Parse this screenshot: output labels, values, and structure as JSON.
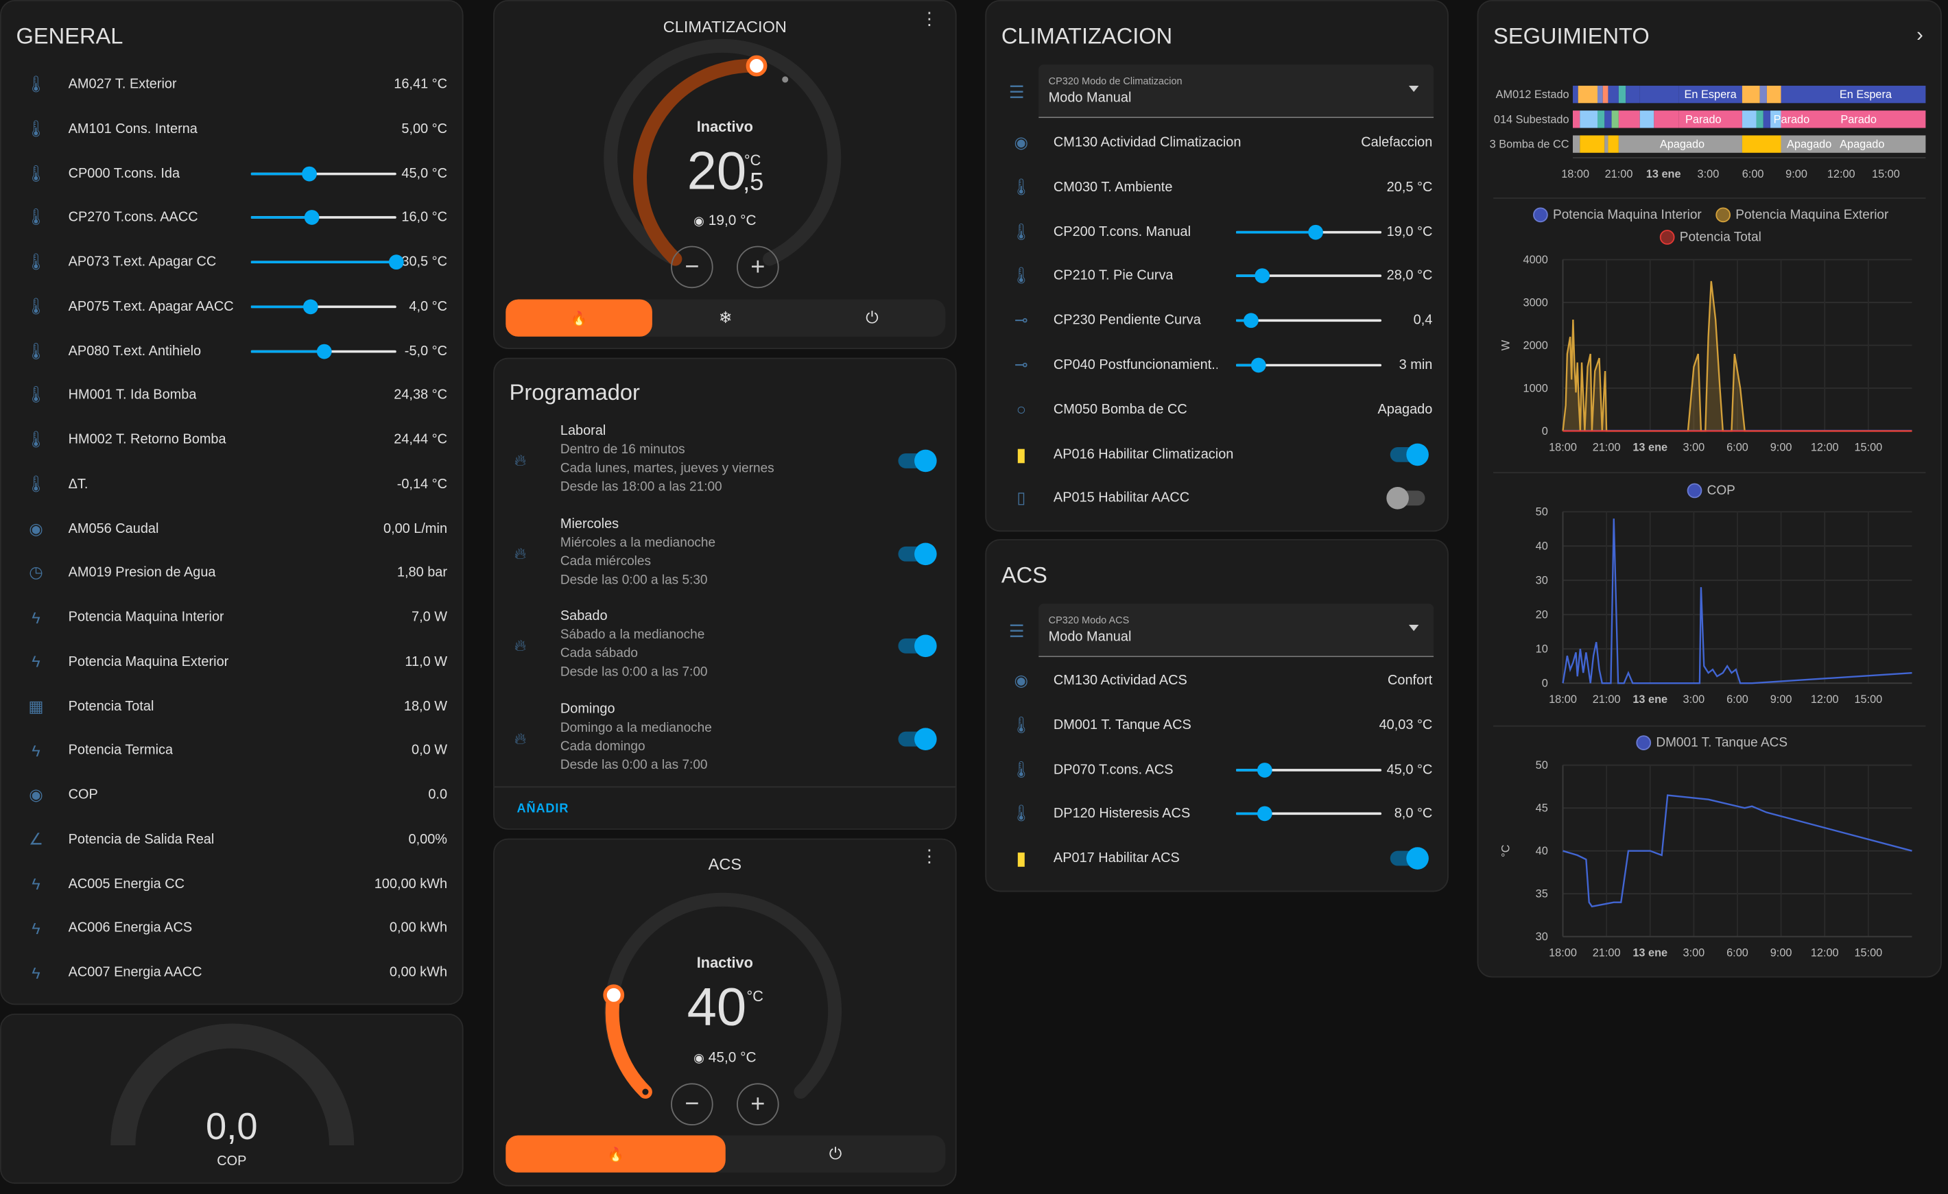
{
  "general": {
    "title": "GENERAL",
    "rows": [
      {
        "icon": "thermometer-icon",
        "label": "AM027 T. Exterior",
        "value": "16,41 °C"
      },
      {
        "icon": "thermometer-icon",
        "label": "AM101 Cons. Interna",
        "value": "5,00 °C"
      },
      {
        "icon": "thermometer-icon",
        "label": "CP000 T.cons. Ida",
        "value": "45,0 °C",
        "slider": 0.4
      },
      {
        "icon": "thermometer-icon",
        "label": "CP270 T.cons. AACC",
        "value": "16,0 °C",
        "slider": 0.42
      },
      {
        "icon": "thermometer-icon",
        "label": "AP073 T.ext. Apagar CC",
        "value": "30,5 °C",
        "slider": 1.0
      },
      {
        "icon": "thermometer-icon",
        "label": "AP075 T.ext. Apagar AACC",
        "value": "4,0 °C",
        "slider": 0.41
      },
      {
        "icon": "thermometer-icon",
        "label": "AP080 T.ext. Antihielo",
        "value": "-5,0 °C",
        "slider": 0.5
      },
      {
        "icon": "thermometer-icon",
        "label": "HM001 T. Ida Bomba",
        "value": "24,38 °C"
      },
      {
        "icon": "thermometer-icon",
        "label": "HM002 T. Retorno Bomba",
        "value": "24,44 °C"
      },
      {
        "icon": "thermometer-icon",
        "label": "ΔT.",
        "value": "-0,14 °C"
      },
      {
        "icon": "eye-icon",
        "label": "AM056 Caudal",
        "value": "0,00 L/min"
      },
      {
        "icon": "gauge-icon",
        "label": "AM019 Presion de Agua",
        "value": "1,80 bar"
      },
      {
        "icon": "flash-icon",
        "label": "Potencia Maquina Interior",
        "value": "7,0 W"
      },
      {
        "icon": "flash-icon",
        "label": "Potencia Maquina Exterior",
        "value": "11,0 W"
      },
      {
        "icon": "calculator-icon",
        "label": "Potencia Total",
        "value": "18,0 W"
      },
      {
        "icon": "flash-icon",
        "label": "Potencia Termica",
        "value": "0,0 W"
      },
      {
        "icon": "eye-icon",
        "label": "COP",
        "value": "0.0"
      },
      {
        "icon": "angle-icon",
        "label": "Potencia de Salida Real",
        "value": "0,00%"
      },
      {
        "icon": "lightning-icon",
        "label": "AC005 Energia CC",
        "value": "100,00 kWh"
      },
      {
        "icon": "lightning-icon",
        "label": "AC006 Energia ACS",
        "value": "0,00 kWh"
      },
      {
        "icon": "lightning-icon",
        "label": "AC007 Energia AACC",
        "value": "0,00 kWh"
      }
    ]
  },
  "cop_gauge": {
    "value": "0,0",
    "label": "COP",
    "fraction": 0
  },
  "thermostat_clim": {
    "title": "CLIMATIZACION",
    "status": "Inactivo",
    "temp_int": "20",
    "temp_dec": ",5",
    "unit": "°C",
    "target": "19,0 °C",
    "minus": "−",
    "plus": "+",
    "modes": [
      {
        "icon": "flame-icon",
        "glyph": "🔥",
        "active": true
      },
      {
        "icon": "snowflake-icon",
        "glyph": "❄",
        "active": false
      },
      {
        "icon": "power-icon",
        "glyph": "⏻",
        "active": false
      }
    ]
  },
  "programador": {
    "title": "Programador",
    "add": "AÑADIR",
    "items": [
      {
        "title": "Laboral",
        "lines": [
          "Dentro de 16 minutos",
          "Cada lunes, martes, jueves y viernes",
          "Desde las 18:00 a las 21:00"
        ]
      },
      {
        "title": "Miercoles",
        "lines": [
          "Miércoles a la medianoche",
          "Cada miércoles",
          "Desde las 0:00 a las 5:30"
        ]
      },
      {
        "title": "Sabado",
        "lines": [
          "Sábado a la medianoche",
          "Cada sábado",
          "Desde las 0:00 a las 7:00"
        ]
      },
      {
        "title": "Domingo",
        "lines": [
          "Domingo a la medianoche",
          "Cada domingo",
          "Desde las 0:00 a las 7:00"
        ]
      }
    ]
  },
  "thermostat_acs": {
    "title": "ACS",
    "status": "Inactivo",
    "temp_int": "40",
    "unit": "°C",
    "target": "45,0 °C",
    "minus": "−",
    "plus": "+",
    "modes": [
      {
        "icon": "flame-icon",
        "glyph": "🔥",
        "active": true
      },
      {
        "icon": "power-icon",
        "glyph": "⏻",
        "active": false
      }
    ]
  },
  "climatizacion": {
    "title": "CLIMATIZACION",
    "select": {
      "label": "CP320 Modo de Climatizacion",
      "value": "Modo Manual"
    },
    "rows": [
      {
        "icon": "eye-icon",
        "label": "CM130 Actividad Climatizacion",
        "value": "Calefaccion"
      },
      {
        "icon": "thermometer-icon",
        "label": "CM030 T. Ambiente",
        "value": "20,5 °C"
      },
      {
        "icon": "thermometer-icon",
        "label": "CP200 T.cons. Manual",
        "value": "19,0 °C",
        "slider": 0.55
      },
      {
        "icon": "thermometer-icon",
        "label": "CP210 T. Pie Curva",
        "value": "28,0 °C",
        "slider": 0.18
      },
      {
        "icon": "slope-icon",
        "label": "CP230 Pendiente Curva",
        "value": "0,4",
        "slider": 0.1
      },
      {
        "icon": "slope-icon",
        "label": "CP040 Postfuncionamient...",
        "value": "3 min",
        "slider": 0.15
      },
      {
        "icon": "circle-icon",
        "label": "CM050 Bomba de CC",
        "value": "Apagado"
      },
      {
        "icon": "battery-icon",
        "label": "AP016 Habilitar Climatizacion",
        "toggle": true
      },
      {
        "icon": "phone-icon",
        "label": "AP015 Habilitar AACC",
        "toggle": false
      }
    ]
  },
  "acs": {
    "title": "ACS",
    "select": {
      "label": "CP320 Modo ACS",
      "value": "Modo Manual"
    },
    "rows": [
      {
        "icon": "eye-icon",
        "label": "CM130 Actividad ACS",
        "value": "Confort"
      },
      {
        "icon": "thermometer-icon",
        "label": "DM001 T. Tanque ACS",
        "value": "40,03 °C"
      },
      {
        "icon": "thermometer-icon",
        "label": "DP070 T.cons. ACS",
        "value": "45,0 °C",
        "slider": 0.2
      },
      {
        "icon": "thermometer-icon",
        "label": "DP120 Histeresis ACS",
        "value": "8,0 °C",
        "slider": 0.2
      },
      {
        "icon": "battery-icon",
        "label": "AP017 Habilitar ACS",
        "toggle": true
      }
    ]
  },
  "seguimiento": {
    "title": "SEGUIMIENTO",
    "timeline": {
      "rows": [
        {
          "label": "AM012 Estado",
          "texts": [
            "En Espera",
            "En Espera"
          ]
        },
        {
          "label": "014 Subestado",
          "texts": [
            "Parado",
            "Parado",
            "Parado"
          ]
        },
        {
          "label": "3 Bomba de CC",
          "texts": [
            "Apagado",
            "Apagado",
            "Apagado"
          ]
        }
      ],
      "ticks": [
        "18:00",
        "21:00",
        "13 ene",
        "3:00",
        "6:00",
        "9:00",
        "12:00",
        "15:00"
      ]
    }
  },
  "chart_data": [
    {
      "type": "line",
      "title": "",
      "ylabel": "W",
      "ylim": [
        0,
        4000
      ],
      "yticks": [
        0,
        1000,
        2000,
        3000,
        4000
      ],
      "xticks": [
        "18:00",
        "21:00",
        "13 ene",
        "3:00",
        "6:00",
        "9:00",
        "12:00",
        "15:00"
      ],
      "series": [
        {
          "name": "Potencia Maquina Interior",
          "color": "#3f51b5",
          "x": [
            0,
            24
          ],
          "values": [
            10,
            10
          ]
        },
        {
          "name": "Potencia Maquina Exterior",
          "color": "#d4a13a",
          "x": [
            0,
            0.2,
            0.3,
            0.5,
            0.6,
            0.7,
            0.8,
            0.9,
            1.0,
            1.1,
            1.2,
            1.3,
            1.5,
            1.7,
            1.9,
            2.0,
            2.2,
            2.5,
            2.7,
            2.9,
            3.0,
            3.3,
            3.5,
            4.0,
            5.0,
            6.0,
            7.0,
            8.0,
            8.6,
            9.0,
            9.3,
            9.5,
            9.8,
            10.0,
            10.2,
            10.5,
            10.8,
            11.0,
            11.3,
            11.6,
            11.8,
            12.2,
            12.5,
            12.8,
            13.0,
            13.2,
            13.5,
            14.0,
            15.0,
            24
          ],
          "values": [
            0,
            600,
            1800,
            2200,
            1200,
            2600,
            1500,
            900,
            1600,
            600,
            0,
            1600,
            0,
            1500,
            1800,
            0,
            1400,
            1700,
            0,
            1400,
            0,
            0,
            0,
            0,
            0,
            0,
            0,
            0,
            0,
            1500,
            1800,
            0,
            0,
            2200,
            3500,
            2600,
            1000,
            0,
            0,
            0,
            1800,
            1000,
            0,
            0,
            0,
            0,
            0,
            0,
            0,
            0
          ]
        },
        {
          "name": "Potencia Total",
          "color": "#e53935",
          "x": [
            0,
            24
          ],
          "values": [
            0,
            0
          ]
        }
      ]
    },
    {
      "type": "line",
      "title": "",
      "ylim": [
        0,
        50
      ],
      "yticks": [
        0,
        10,
        20,
        30,
        40,
        50
      ],
      "xticks": [
        "18:00",
        "21:00",
        "13 ene",
        "3:00",
        "6:00",
        "9:00",
        "12:00",
        "15:00"
      ],
      "series": [
        {
          "name": "COP",
          "color": "#4266d4",
          "x": [
            0,
            0.2,
            0.3,
            0.5,
            0.7,
            0.9,
            1.0,
            1.2,
            1.4,
            1.6,
            1.9,
            2.1,
            2.3,
            2.5,
            2.7,
            3.0,
            3.3,
            3.5,
            3.8,
            4.2,
            4.5,
            4.8,
            5.2,
            6.0,
            8.0,
            9.4,
            9.5,
            9.7,
            10.0,
            10.3,
            10.6,
            11.0,
            11.3,
            11.6,
            11.9,
            12.2,
            13.0,
            24
          ],
          "values": [
            0,
            5,
            8,
            4,
            6,
            9,
            2,
            10,
            3,
            9,
            0,
            8,
            12,
            4,
            0,
            0,
            0,
            48,
            0,
            0,
            3,
            0,
            0,
            0,
            0,
            0,
            28,
            5,
            3,
            4,
            2,
            3,
            5,
            3,
            4,
            0,
            0,
            3
          ]
        }
      ]
    },
    {
      "type": "line",
      "title": "",
      "ylabel": "°C",
      "ylim": [
        30,
        50
      ],
      "yticks": [
        30,
        35,
        40,
        45,
        50
      ],
      "xticks": [
        "18:00",
        "21:00",
        "13 ene",
        "3:00",
        "6:00",
        "9:00",
        "12:00",
        "15:00"
      ],
      "series": [
        {
          "name": "DM001 T. Tanque ACS",
          "color": "#4266d4",
          "x": [
            0,
            1.0,
            1.6,
            1.8,
            2.0,
            3.5,
            4.0,
            4.5,
            6.0,
            6.8,
            7.2,
            10.0,
            12.5,
            13.0,
            14.0,
            24
          ],
          "values": [
            40,
            39.5,
            39,
            34,
            33.5,
            34,
            34,
            40,
            40,
            39.5,
            46.5,
            46,
            45,
            45.2,
            44.5,
            40
          ]
        }
      ]
    }
  ]
}
